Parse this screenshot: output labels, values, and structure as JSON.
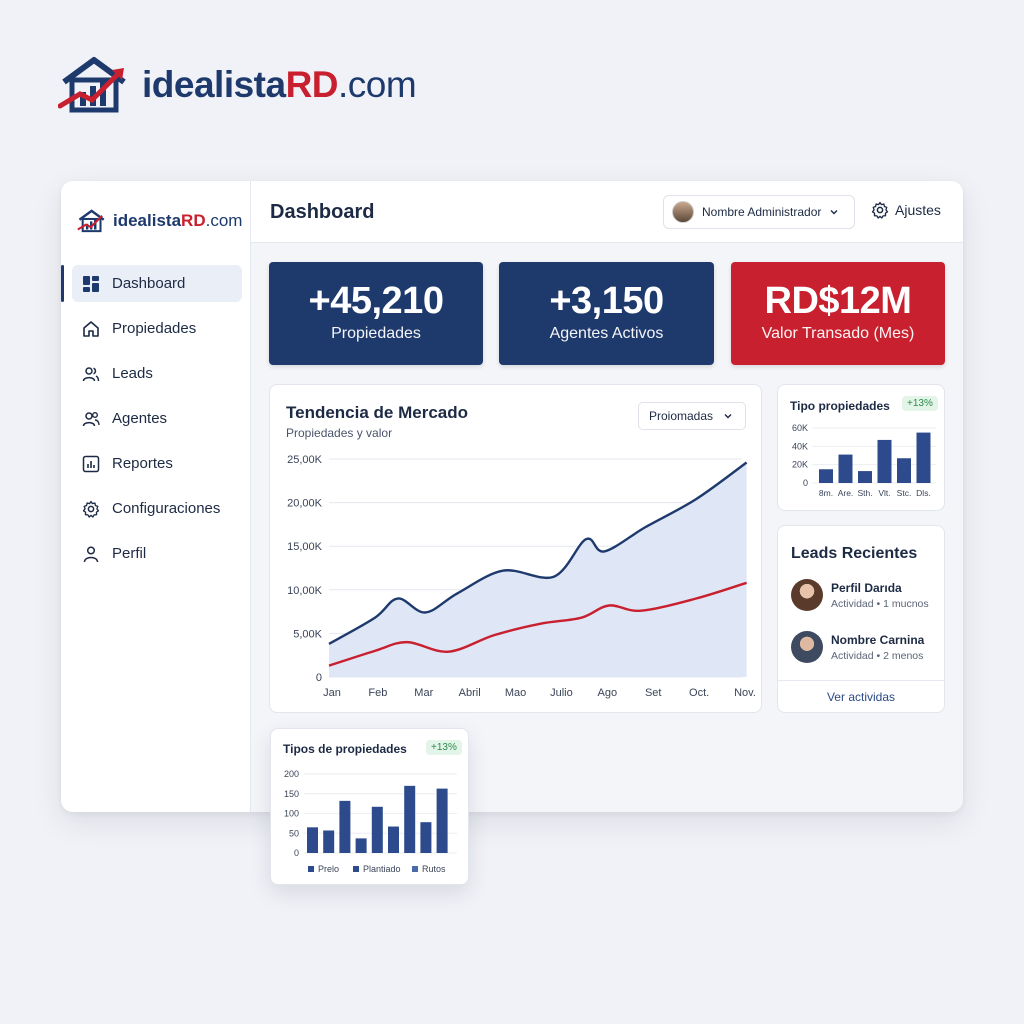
{
  "brand": {
    "part1": "idealista",
    "part2": "RD",
    "part3": ".com"
  },
  "colors": {
    "navy": "#1e3a6d",
    "red": "#c8202f",
    "blue_line": "#1e3a6d",
    "red_line": "#c8202f",
    "bar": "#2c4a8c"
  },
  "sidebar": {
    "items": [
      {
        "label": "Dashboard",
        "icon": "grid-icon",
        "active": true
      },
      {
        "label": "Propiedades",
        "icon": "home-icon"
      },
      {
        "label": "Leads",
        "icon": "users-icon"
      },
      {
        "label": "Agentes",
        "icon": "agents-icon"
      },
      {
        "label": "Reportes",
        "icon": "chart-icon"
      },
      {
        "label": "Configuraciones",
        "icon": "gear-icon"
      },
      {
        "label": "Perfil",
        "icon": "user-icon"
      }
    ]
  },
  "header": {
    "title": "Dashboard",
    "user_name": "Nombre Administrador",
    "settings_label": "Ajustes"
  },
  "stats": [
    {
      "value": "+45,210",
      "label": "Propiedades"
    },
    {
      "value": "+3,150",
      "label": "Agentes Activos"
    },
    {
      "value": "RD$12M",
      "label": "Valor Transado (Mes)"
    }
  ],
  "market": {
    "title": "Tendencia de Mercado",
    "subtitle": "Propiedades y valor",
    "dropdown": "Proiomadas"
  },
  "types_small": {
    "title": "Tipo propiedades",
    "badge": "+13%"
  },
  "leads": {
    "title": "Leads Recientes",
    "items": [
      {
        "name": "Perfil Darıda",
        "meta": "Actividad • 1 mucnos"
      },
      {
        "name": "Nombre Carnina",
        "meta": "Actividad • 2 menos"
      }
    ],
    "footer": "Ver actividas"
  },
  "types_float": {
    "title": "Tipos de propiedades",
    "badge": "+13%"
  },
  "chart_data": [
    {
      "type": "area",
      "categories": [
        "Jan",
        "Feb",
        "Mar",
        "Abril",
        "Mao",
        "Julio",
        "Ago",
        "Set",
        "Oct.",
        "Nov."
      ],
      "y_ticks": [
        "25,00K",
        "20,00K",
        "15,00K",
        "10,00K",
        "5,00K",
        "0"
      ],
      "ylim": [
        0,
        25000
      ],
      "series": [
        {
          "values": [
            3800,
            6800,
            9000,
            7400,
            9600,
            12200,
            11500,
            15800,
            14400,
            17200,
            20400,
            24600
          ],
          "x": [
            0,
            1,
            1.5,
            2.1,
            2.8,
            3.8,
            4.9,
            5.6,
            6.0,
            6.9,
            8.0,
            9.1
          ]
        },
        {
          "values": [
            1300,
            3000,
            4000,
            2900,
            4800,
            6100,
            6800,
            8200,
            7600,
            9000,
            10800
          ],
          "x": [
            0,
            1,
            1.7,
            2.6,
            3.6,
            4.6,
            5.5,
            6.1,
            6.8,
            8.0,
            9.1
          ]
        }
      ]
    },
    {
      "type": "bar",
      "categories": [
        "8m.",
        "Are.",
        "Sth.",
        "Vlt.",
        "Stc.",
        "Dls."
      ],
      "y_ticks": [
        "60K",
        "40K",
        "20K",
        "0"
      ],
      "ylim": [
        0,
        60
      ],
      "values": [
        15,
        31,
        13,
        47,
        27,
        55
      ]
    },
    {
      "type": "bar",
      "y_ticks": [
        "200",
        "150",
        "100",
        "50",
        "0"
      ],
      "ylim": [
        0,
        200
      ],
      "values": [
        65,
        57,
        132,
        37,
        117,
        67,
        170,
        78,
        163
      ],
      "legend": [
        "Prelo",
        "Plantiado",
        "Rutos"
      ]
    }
  ]
}
